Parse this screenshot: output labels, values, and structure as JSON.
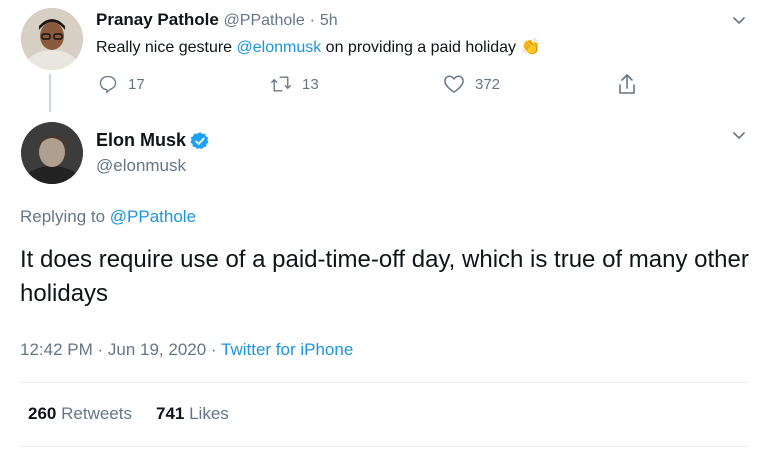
{
  "reply_to_tweet": {
    "author_name": "Pranay Pathole",
    "author_handle": "@PPathole",
    "dot": "·",
    "time": "5h",
    "text_before": "Really nice gesture ",
    "mention": "@elonmusk",
    "text_after": " on providing a paid holiday",
    "emoji": "👏",
    "actions": {
      "replies": "17",
      "retweets": "13",
      "likes": "372"
    }
  },
  "main_tweet": {
    "author_name": "Elon Musk",
    "author_handle": "@elonmusk",
    "replying_prefix": "Replying to ",
    "replying_handle": "@PPathole",
    "text": "It does require use of a paid-time-off day, which is true of many other holidays",
    "timestamp": "12:42 PM · Jun 19, 2020",
    "dot": "·",
    "source": "Twitter for iPhone",
    "stats": {
      "retweets_count": "260",
      "retweets_label": "Retweets",
      "likes_count": "741",
      "likes_label": "Likes"
    }
  },
  "colors": {
    "link": "#1b95e0",
    "muted": "#657786",
    "verified": "#1da1f2",
    "text": "#0f1419"
  }
}
